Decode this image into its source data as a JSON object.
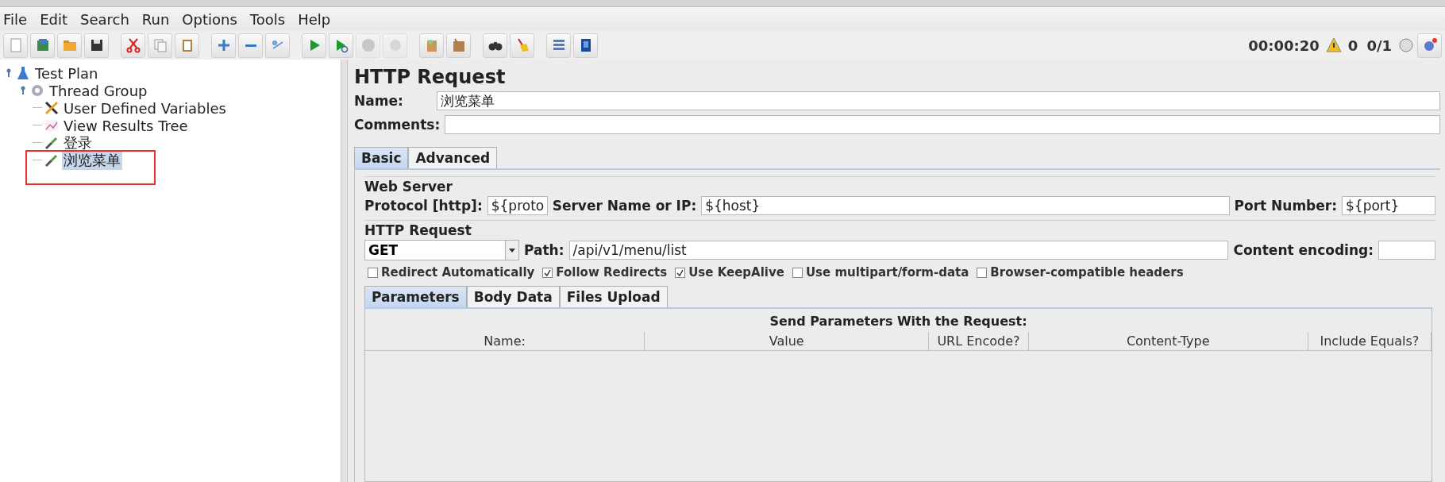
{
  "menu": [
    "File",
    "Edit",
    "Search",
    "Run",
    "Options",
    "Tools",
    "Help"
  ],
  "toolbar": [
    {
      "disabled": false
    },
    {
      "disabled": false
    },
    {
      "disabled": false
    },
    {
      "disabled": false
    },
    {
      "disabled": false
    },
    {
      "disabled": false
    },
    {
      "disabled": false
    },
    {
      "disabled": false
    },
    {
      "disabled": false
    },
    {
      "disabled": false
    },
    {
      "disabled": false
    },
    {
      "disabled": false
    },
    {
      "disabled": true
    },
    {
      "disabled": true
    },
    {
      "disabled": false
    },
    {
      "disabled": false
    },
    {
      "disabled": false
    },
    {
      "disabled": false
    },
    {
      "disabled": false
    },
    {
      "disabled": false
    }
  ],
  "status": {
    "elapsed": "00:00:20",
    "warnings": "0",
    "threads": "0/1"
  },
  "tree": [
    {
      "label": "Test Plan",
      "kind": "plan",
      "expanded": true,
      "selected": false,
      "children": [
        {
          "label": "Thread Group",
          "kind": "group",
          "expanded": true,
          "selected": false,
          "children": [
            {
              "label": "User Defined Variables",
              "kind": "variables",
              "selected": false
            },
            {
              "label": "View Results Tree",
              "kind": "listener",
              "selected": false
            },
            {
              "label": "登录",
              "kind": "sampler",
              "selected": false
            },
            {
              "label": "浏览菜单",
              "kind": "sampler",
              "selected": true,
              "annotated": true
            }
          ]
        }
      ]
    }
  ],
  "panel": {
    "title": "HTTP Request",
    "name_label": "Name:",
    "name_value": "浏览菜单",
    "comments_label": "Comments:",
    "tabs": [
      {
        "label": "Basic",
        "selected": true
      },
      {
        "label": "Advanced",
        "selected": false
      }
    ],
    "web_server": {
      "title": "Web Server",
      "protocol_label": "Protocol [http]:",
      "protocol_value": "${proto",
      "server_label": "Server Name or IP:",
      "server_value": "${host}",
      "port_label": "Port Number:",
      "port_value": "${port}"
    },
    "http_request": {
      "title": "HTTP Request",
      "method": "GET",
      "path_label": "Path:",
      "path_value": "/api/v1/menu/list",
      "encoding_label": "Content encoding:",
      "options": [
        {
          "label": "Redirect Automatically",
          "checked": false
        },
        {
          "label": "Follow Redirects",
          "checked": true
        },
        {
          "label": "Use KeepAlive",
          "checked": true
        },
        {
          "label": "Use multipart/form-data",
          "checked": false
        },
        {
          "label": "Browser-compatible headers",
          "checked": false
        }
      ]
    },
    "sub_tabs": [
      {
        "label": "Parameters",
        "selected": true
      },
      {
        "label": "Body Data",
        "selected": false
      },
      {
        "label": "Files Upload",
        "selected": false
      }
    ],
    "table": {
      "title": "Send Parameters With the Request:",
      "columns": [
        "Name:",
        "Value",
        "URL Encode?",
        "Content-Type",
        "Include Equals?"
      ]
    }
  }
}
